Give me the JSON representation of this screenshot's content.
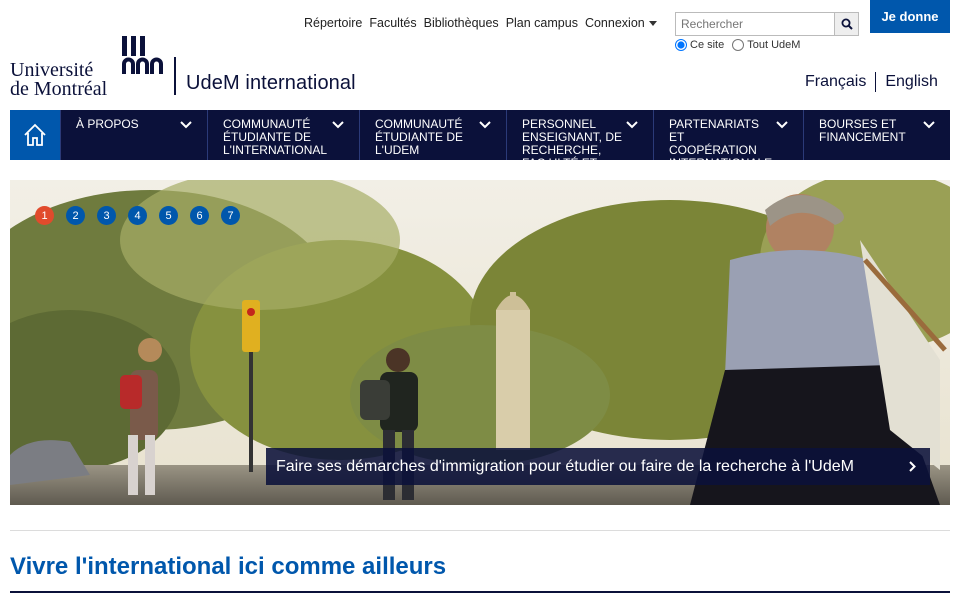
{
  "brand": {
    "university_line1": "Université",
    "university_line2": "de Montréal",
    "site_name": "UdeM international"
  },
  "toplinks": [
    "Répertoire",
    "Facultés",
    "Bibliothèques",
    "Plan campus",
    "Connexion"
  ],
  "search": {
    "placeholder": "Rechercher",
    "scope_options": [
      "Ce site",
      "Tout UdeM"
    ],
    "scope_selected": "Ce site"
  },
  "donate_label": "Je donne",
  "languages": [
    "Français",
    "English"
  ],
  "nav": {
    "home_icon": "home-icon",
    "items": [
      "À propos",
      "Communauté étudiante de l'international",
      "Communauté étudiante de l'UdeM",
      "Personnel enseignant, de recherche, fac ulté et",
      "Partenariats et coopération internationale",
      "Bourses et financement"
    ]
  },
  "hero": {
    "slides": [
      "1",
      "2",
      "3",
      "4",
      "5",
      "6",
      "7"
    ],
    "active_slide": "1",
    "caption": "Faire ses démarches d'immigration pour étudier ou faire de la recherche à l'UdeM"
  },
  "section_title": "Vivre l'international ici comme ailleurs",
  "colors": {
    "navy": "#0b113a",
    "blue": "#0057ac",
    "active_dot": "#e14b2c"
  }
}
